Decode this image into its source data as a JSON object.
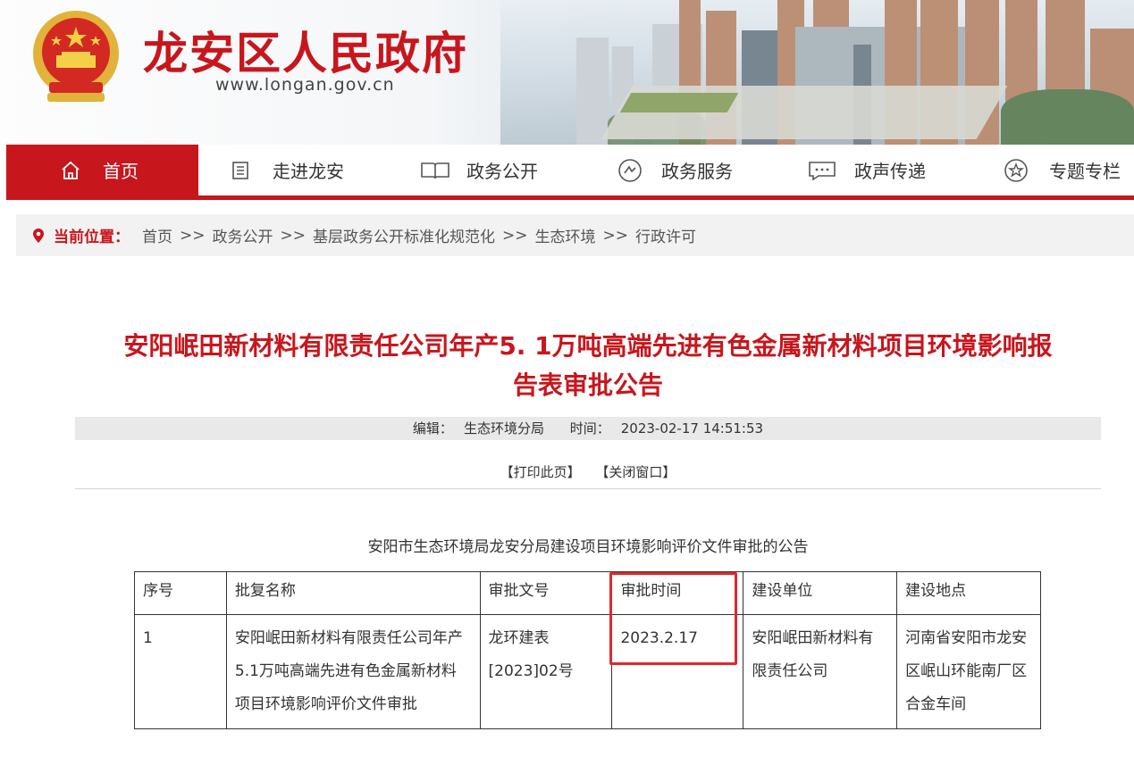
{
  "header": {
    "site_title": "龙安区人民政府",
    "site_url": "www.longan.gov.cn",
    "brand_color": "#c8161d"
  },
  "nav": {
    "items": [
      {
        "label": "首页",
        "icon": "home-icon",
        "active": true
      },
      {
        "label": "走进龙安",
        "icon": "list-icon",
        "active": false
      },
      {
        "label": "政务公开",
        "icon": "book-icon",
        "active": false
      },
      {
        "label": "政务服务",
        "icon": "service-icon",
        "active": false
      },
      {
        "label": "政声传递",
        "icon": "message-icon",
        "active": false
      },
      {
        "label": "专题专栏",
        "icon": "star-icon",
        "active": false
      }
    ]
  },
  "breadcrumb": {
    "label": "当前位置：",
    "items": [
      "首页",
      "政务公开",
      "基层政务公开标准化规范化",
      "生态环境",
      "行政许可"
    ],
    "separator": ">>"
  },
  "article": {
    "title_line1": "安阳岷田新材料有限责任公司年产5. 1万吨高端先进有色金属新材料项目环境影响报",
    "title_line2": "告表审批公告",
    "editor_label": "编辑：",
    "editor": "生态环境分局",
    "time_label": "时间：",
    "time": "2023-02-17 14:51:53",
    "print_link": "【打印此页】",
    "close_link": "【关闭窗口】",
    "table_caption": "安阳市生态环境局龙安分局建设项目环境影响评价文件审批的公告"
  },
  "table": {
    "headers": [
      "序号",
      "批复名称",
      "审批文号",
      "审批时间",
      "建设单位",
      "建设地点"
    ],
    "rows": [
      {
        "no": "1",
        "name": "安阳岷田新材料有限责任公司年产5.1万吨高端先进有色金属新材料项目环境影响评价文件审批",
        "doc_no": "龙环建表[2023]02号",
        "date": "2023.2.17",
        "unit": "安阳岷田新材料有限责任公司",
        "location": "河南省安阳市龙安区岷山环能南厂区合金车间"
      }
    ],
    "highlight_color": "#e0282d"
  }
}
